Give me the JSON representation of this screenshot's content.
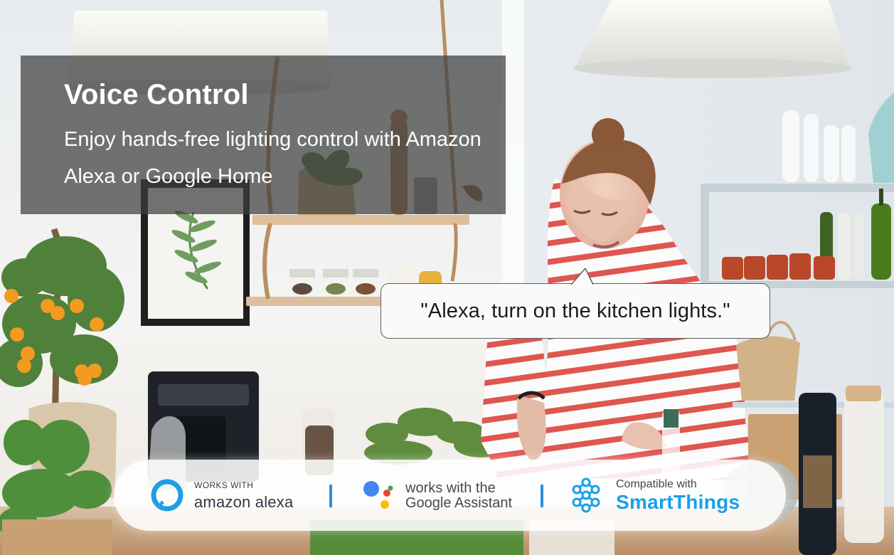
{
  "hero": {
    "title": "Voice Control",
    "subtitle": "Enjoy hands-free lighting control with Amazon Alexa or Google Home"
  },
  "speech": {
    "quote": "\"Alexa, turn on the kitchen lights.\""
  },
  "compatibility": {
    "alexa": {
      "top_text": "WORKS WITH",
      "bottom_text": "amazon alexa",
      "icon": "alexa-ring-icon",
      "accent": "#1f9fe3"
    },
    "google": {
      "top_text": "works with the",
      "bottom_text": "Google Assistant",
      "icon": "google-assistant-icon",
      "colors": [
        "#4285F4",
        "#EA4335",
        "#FBBC05",
        "#34A853"
      ]
    },
    "smartthings": {
      "top_text": "Compatible with",
      "bottom_text": "SmartThings",
      "icon": "smartthings-icon",
      "accent": "#18a0e8"
    }
  },
  "colors": {
    "panel_overlay": "#3e3e3e",
    "divider": "#2b8fd6",
    "bubble_border": "#5e5e5e"
  }
}
